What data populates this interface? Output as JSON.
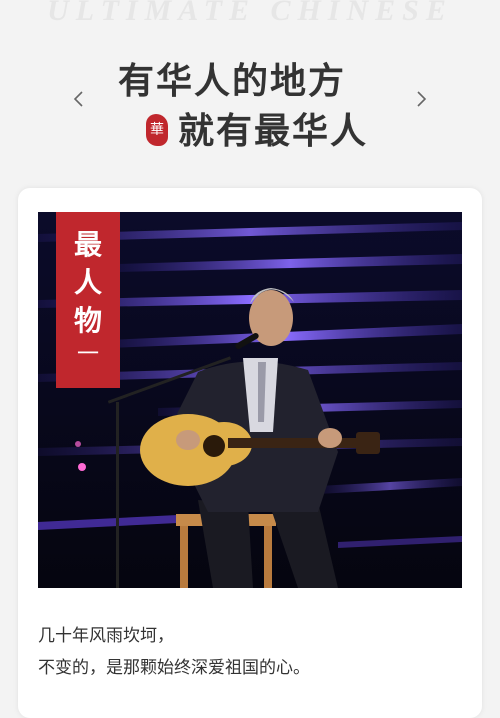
{
  "watermark": "ULTIMATE CHINESE",
  "header": {
    "line1": "有华人的地方",
    "line2": "就有最华人",
    "seal_char": "華"
  },
  "card": {
    "tag": {
      "chars": [
        "最",
        "人",
        "物"
      ],
      "dash": "一"
    },
    "caption": {
      "line1": "几十年风雨坎坷，",
      "line2": "不变的，是那颗始终深爱祖国的心。"
    }
  },
  "colors": {
    "accent": "#c0272d",
    "stage_dark": "#0a0a22",
    "stage_light": "#7a55ff"
  },
  "icons": {
    "prev": "chevron-left-icon",
    "next": "chevron-right-icon"
  }
}
